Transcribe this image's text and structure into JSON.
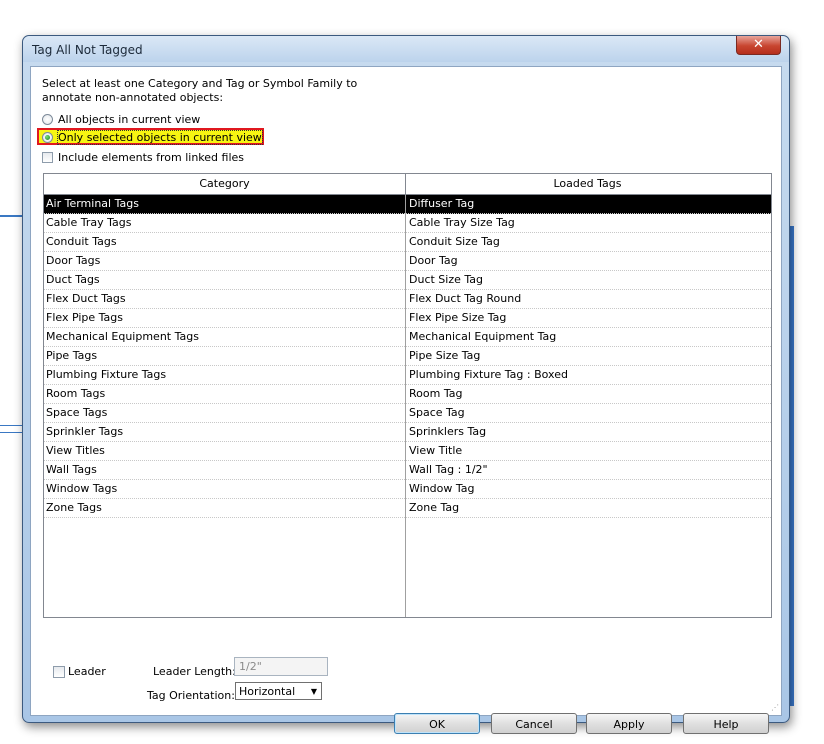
{
  "window": {
    "title": "Tag All Not Tagged",
    "close_glyph": "✕"
  },
  "intro": "Select at least one Category and Tag or Symbol Family to annotate non-annotated objects:",
  "scope": {
    "all_objects": "All objects in current view",
    "only_selected": "Only selected objects in current view",
    "selected_option": "only_selected"
  },
  "include_linked": {
    "label": "Include elements from linked files",
    "checked": false
  },
  "grid": {
    "headers": [
      "Category",
      "Loaded Tags"
    ],
    "rows": [
      {
        "category": "Air Terminal Tags",
        "tag": "Diffuser Tag",
        "selected": true
      },
      {
        "category": "Cable Tray Tags",
        "tag": "Cable Tray Size Tag"
      },
      {
        "category": "Conduit Tags",
        "tag": "Conduit Size Tag"
      },
      {
        "category": "Door Tags",
        "tag": "Door Tag"
      },
      {
        "category": "Duct Tags",
        "tag": "Duct Size Tag"
      },
      {
        "category": "Flex Duct Tags",
        "tag": "Flex Duct Tag Round"
      },
      {
        "category": "Flex Pipe Tags",
        "tag": "Flex Pipe Size Tag"
      },
      {
        "category": "Mechanical Equipment Tags",
        "tag": "Mechanical Equipment Tag"
      },
      {
        "category": "Pipe Tags",
        "tag": "Pipe Size Tag"
      },
      {
        "category": "Plumbing Fixture Tags",
        "tag": "Plumbing Fixture Tag : Boxed"
      },
      {
        "category": "Room Tags",
        "tag": "Room Tag"
      },
      {
        "category": "Space Tags",
        "tag": "Space Tag"
      },
      {
        "category": "Sprinkler Tags",
        "tag": "Sprinklers Tag"
      },
      {
        "category": "View Titles",
        "tag": "View Title"
      },
      {
        "category": "Wall Tags",
        "tag": "Wall Tag : 1/2\""
      },
      {
        "category": "Window Tags",
        "tag": "Window Tag"
      },
      {
        "category": "Zone Tags",
        "tag": "Zone Tag"
      }
    ]
  },
  "leader": {
    "label": "Leader",
    "checked": false
  },
  "leader_length": {
    "label": "Leader Length:",
    "value": "1/2\""
  },
  "tag_orientation": {
    "label": "Tag Orientation:",
    "value": "Horizontal"
  },
  "buttons": {
    "ok": "OK",
    "cancel": "Cancel",
    "apply": "Apply",
    "help": "Help"
  },
  "colors": {
    "highlight_fill": "#f7f512",
    "highlight_border": "#e0181f",
    "selected_row": "#000000"
  }
}
